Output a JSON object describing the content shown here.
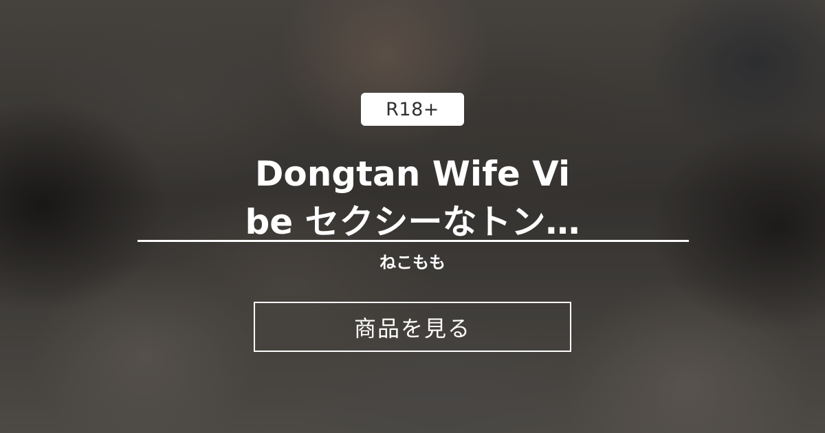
{
  "badge": {
    "label": "R18+"
  },
  "product": {
    "title_line1": "Dongtan Wife Vi",
    "title_line2": "be セクシーなトン…"
  },
  "author": {
    "name": "ねこもも"
  },
  "cta": {
    "label": "商品を見る"
  },
  "colors": {
    "text": "#ffffff",
    "badge_bg": "#ffffff",
    "badge_text": "#2f2f2f"
  }
}
